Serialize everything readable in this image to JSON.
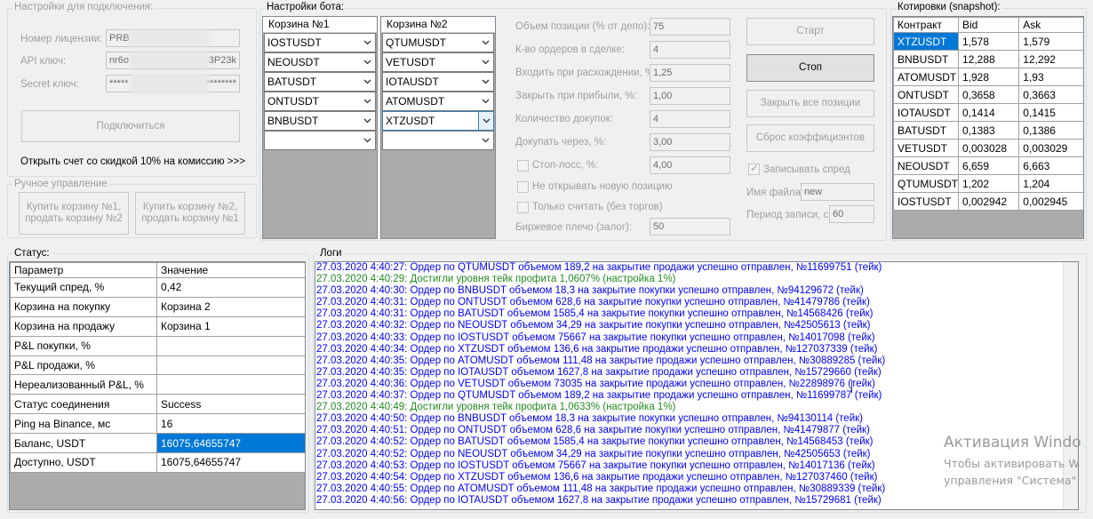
{
  "connection": {
    "title": "Настройки для подключения:",
    "license_label": "Номер лицензии:",
    "license_value": "PRB",
    "api_label": "API ключ:",
    "api_value": "nr6o",
    "api_suffix": "3P23k",
    "secret_label": "Secret ключ:",
    "secret_value": "*****",
    "secret_suffix": "********",
    "connect_button": "Подключиться",
    "discount_link": "Открыть счет со скидкой 10% на комиссию >>>"
  },
  "manual": {
    "title": "Ручное управление",
    "buy1_button": "Купить корзину №1, продать корзину №2",
    "buy2_button": "Купить корзину №2, продать корзину №1"
  },
  "bot": {
    "title": "Настройки бота:",
    "basket1_header": "Корзина №1",
    "basket2_header": "Корзина №2",
    "basket1": [
      "IOSTUSDT",
      "NEOUSDT",
      "BATUSDT",
      "ONTUSDT",
      "BNBUSDT",
      ""
    ],
    "basket2": [
      "QTUMUSDT",
      "VETUSDT",
      "IOTAUSDT",
      "ATOMUSDT",
      "XTZUSDT",
      ""
    ],
    "params": [
      {
        "label": "Объем позиции (% от депо):",
        "value": "75"
      },
      {
        "label": "К-во ордеров в сделке:",
        "value": "4"
      },
      {
        "label": "Входить при расхождении, %:",
        "value": "1,25"
      },
      {
        "label": "Закрыть при прибыли, %:",
        "value": "1,00"
      },
      {
        "label": "Количество докупок:",
        "value": "4"
      },
      {
        "label": "Докупать через, %:",
        "value": "3,00"
      },
      {
        "label": "Стоп-лосс, %:",
        "value": "4,00"
      }
    ],
    "no_new_position": "Не открывать новую позицию",
    "count_only": "Только считать (без торгов)",
    "leverage_label": "Биржевое плечо (залог):",
    "leverage_value": "50",
    "start_button": "Старт",
    "stop_button": "Стоп",
    "close_all_button": "Закрыть все позиции",
    "reset_button": "Сброс коэффициэнтов",
    "record_spread": "Записывать спред",
    "filename_label": "Имя файла:",
    "filename_value": "new",
    "period_label": "Период записи, с",
    "period_value": "60"
  },
  "quotes": {
    "title": "Котировки (snapshot):",
    "headers": [
      "Контракт",
      "Bid",
      "Ask"
    ],
    "rows": [
      [
        "XTZUSDT",
        "1,578",
        "1,579"
      ],
      [
        "BNBUSDT",
        "12,288",
        "12,292"
      ],
      [
        "ATOMUSDT",
        "1,928",
        "1,93"
      ],
      [
        "ONTUSDT",
        "0,3658",
        "0,3663"
      ],
      [
        "IOTAUSDT",
        "0,1414",
        "0,1415"
      ],
      [
        "BATUSDT",
        "0,1383",
        "0,1386"
      ],
      [
        "VETUSDT",
        "0,003028",
        "0,003029"
      ],
      [
        "NEOUSDT",
        "6,659",
        "6,663"
      ],
      [
        "QTUMUSDT",
        "1,202",
        "1,204"
      ],
      [
        "IOSTUSDT",
        "0,002942",
        "0,002945"
      ]
    ]
  },
  "status": {
    "title": "Статус:",
    "headers": [
      "Параметр",
      "Значение"
    ],
    "rows": [
      [
        "Текущий спред, %",
        "0,42"
      ],
      [
        "Корзина на покупку",
        "Корзина 2"
      ],
      [
        "Корзина на продажу",
        "Корзина 1"
      ],
      [
        "P&L покупки, %",
        ""
      ],
      [
        "P&L продажи, %",
        ""
      ],
      [
        "Нереализованный P&L, %",
        ""
      ],
      [
        "Статус соединения",
        "Success"
      ],
      [
        "Ping на Binance, мс",
        "16"
      ],
      [
        "Баланс, USDT",
        "16075,64655747"
      ],
      [
        "Доступно, USDT",
        "16075,64655747"
      ]
    ]
  },
  "logs": {
    "title": "Логи",
    "lines": [
      {
        "text": "27.03.2020 4:40:27: Ордер по QTUMUSDT объемом 189,2 на закрытие продажи успешно отправлен, №11699751 (тейк)",
        "kind": "order"
      },
      {
        "text": "27.03.2020 4:40:29: Достигли уровня тейк профита 1,0607% (настройка 1%)",
        "kind": "profit"
      },
      {
        "text": "27.03.2020 4:40:30: Ордер по BNBUSDT объемом 18,3 на закрытие покупки успешно отправлен, №94129672 (тейк)",
        "kind": "order"
      },
      {
        "text": "27.03.2020 4:40:31: Ордер по ONTUSDT объемом 628,6 на закрытие покупки успешно отправлен, №41479786 (тейк)",
        "kind": "order"
      },
      {
        "text": "27.03.2020 4:40:31: Ордер по BATUSDT объемом 1585,4 на закрытие покупки успешно отправлен, №14568426 (тейк)",
        "kind": "order"
      },
      {
        "text": "27.03.2020 4:40:32: Ордер по NEOUSDT объемом 34,29 на закрытие покупки успешно отправлен, №42505613 (тейк)",
        "kind": "order"
      },
      {
        "text": "27.03.2020 4:40:33: Ордер по IOSTUSDT объемом 75667 на закрытие покупки успешно отправлен, №14017098 (тейк)",
        "kind": "order"
      },
      {
        "text": "27.03.2020 4:40:34: Ордер по XTZUSDT объемом 136,6 на закрытие продажи успешно отправлен, №127037339 (тейк)",
        "kind": "order"
      },
      {
        "text": "27.03.2020 4:40:35: Ордер по ATOMUSDT объемом 111,48 на закрытие продажи успешно отправлен, №30889285 (тейк)",
        "kind": "order"
      },
      {
        "text": "27.03.2020 4:40:35: Ордер по IOTAUSDT объемом 1627,8 на закрытие продажи успешно отправлен, №15729660 (тейк)",
        "kind": "order"
      },
      {
        "text": "27.03.2020 4:40:36: Ордер по VETUSDT объемом 73035 на закрытие продажи успешно отправлен, №22898976 (тейк)",
        "kind": "order"
      },
      {
        "text": "27.03.2020 4:40:37: Ордер по QTUMUSDT объемом 189,2 на закрытие продажи успешно отправлен, №11699787 (тейк)",
        "kind": "order"
      },
      {
        "text": "27.03.2020 4:40:49: Достигли уровня тейк профита 1,0633% (настройка 1%)",
        "kind": "profit"
      },
      {
        "text": "27.03.2020 4:40:50: Ордер по BNBUSDT объемом 18,3 на закрытие покупки успешно отправлен, №94130114 (тейк)",
        "kind": "order"
      },
      {
        "text": "27.03.2020 4:40:51: Ордер по ONTUSDT объемом 628,6 на закрытие покупки успешно отправлен, №41479877 (тейк)",
        "kind": "order"
      },
      {
        "text": "27.03.2020 4:40:52: Ордер по BATUSDT объемом 1585,4 на закрытие покупки успешно отправлен, №14568453 (тейк)",
        "kind": "order"
      },
      {
        "text": "27.03.2020 4:40:52: Ордер по NEOUSDT объемом 34,29 на закрытие покупки успешно отправлен, №42505653 (тейк)",
        "kind": "order"
      },
      {
        "text": "27.03.2020 4:40:53: Ордер по IOSTUSDT объемом 75667 на закрытие покупки успешно отправлен, №14017136 (тейк)",
        "kind": "order"
      },
      {
        "text": "27.03.2020 4:40:54: Ордер по XTZUSDT объемом 136,6 на закрытие продажи успешно отправлен, №127037460 (тейк)",
        "kind": "order"
      },
      {
        "text": "27.03.2020 4:40:55: Ордер по ATOMUSDT объемом 111,48 на закрытие продажи успешно отправлен, №30889339 (тейк)",
        "kind": "order"
      },
      {
        "text": "27.03.2020 4:40:56: Ордер по IOTAUSDT объемом 1627,8 на закрытие продажи успешно отправлен, №15729681 (тейк)",
        "kind": "order"
      }
    ]
  },
  "watermark": {
    "line1": "Активация Windo",
    "line2": "Чтобы активировать W",
    "line3": "управления \"Система\""
  },
  "colors": {
    "log_order": "#0000ff",
    "log_profit": "#228b22",
    "selection": "#0078d7"
  }
}
